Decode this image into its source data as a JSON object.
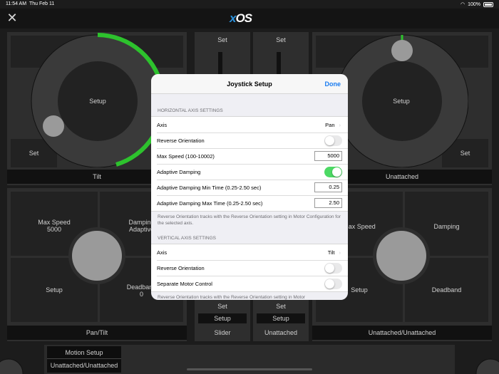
{
  "status": {
    "time": "11:54 AM",
    "date": "Thu Feb 11",
    "battery": "100%"
  },
  "header": {
    "logo_prefix": "x",
    "logo_main": "OS"
  },
  "panels": {
    "tilt": {
      "center": "Setup",
      "set": "Set",
      "caption": "Tilt"
    },
    "slider_set_top": "Set",
    "unattached_set_top": "Set",
    "right_joystick": {
      "center": "Setup",
      "set": "Set",
      "caption": "Unattached"
    },
    "pan_tilt": {
      "max_speed_label": "Max Speed",
      "max_speed_value": "5000",
      "damping_label": "Damping",
      "damping_value": "Adaptive",
      "setup": "Setup",
      "deadband_label": "Deadband",
      "deadband_value": "0",
      "caption": "Pan/Tilt"
    },
    "slider": {
      "set": "Set",
      "setup": "Setup",
      "caption": "Slider"
    },
    "unattached_mid": {
      "set": "Set",
      "setup": "Setup",
      "caption": "Unattached"
    },
    "right_lower": {
      "max_speed_label": "Max Speed",
      "damping_label": "Damping",
      "setup": "Setup",
      "deadband_label": "Deadband",
      "caption": "Unattached/Unattached"
    },
    "bottom": {
      "motion_setup": "Motion Setup",
      "assignment": "Unattached/Unattached"
    }
  },
  "modal": {
    "title": "Joystick Setup",
    "done": "Done",
    "horizontal": {
      "header": "HORIZONTAL AXIS SETTINGS",
      "axis_label": "Axis",
      "axis_value": "Pan",
      "reverse_label": "Reverse Orientation",
      "reverse_on": false,
      "max_speed_label": "Max Speed (100-10002)",
      "max_speed_value": "5000",
      "adaptive_label": "Adaptive Damping",
      "adaptive_on": true,
      "min_time_label": "Adaptive Damping Min Time (0.25-2.50 sec)",
      "min_time_value": "0.25",
      "max_time_label": "Adaptive Damping Max Time (0.25-2.50 sec)",
      "max_time_value": "2.50",
      "footer": "Reverse Orientation tracks with the Reverse Orientation setting in Motor Configuration for the selected axis."
    },
    "vertical": {
      "header": "VERTICAL AXIS SETTINGS",
      "axis_label": "Axis",
      "axis_value": "Tilt",
      "reverse_label": "Reverse Orientation",
      "reverse_on": false,
      "separate_label": "Separate Motor Control",
      "separate_on": false,
      "footer": "Reverse Orientation tracks with the Reverse Orientation setting in Motor"
    }
  },
  "colors": {
    "accent_green": "#2dc22d",
    "toggle_on": "#4cd964",
    "link_blue": "#1a7cf0"
  }
}
